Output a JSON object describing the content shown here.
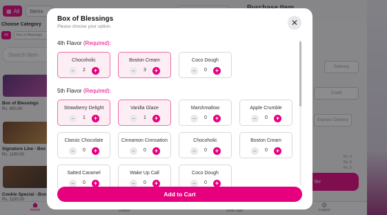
{
  "background": {
    "filter_all": "All",
    "filter_items": "Items",
    "purchase_title": "Purchase Item",
    "choose_category": "Choose Category",
    "category_all": "All",
    "category_box": "Box of Blessings",
    "search_placeholder": "Search Item",
    "products": [
      {
        "name": "Box of Blessings",
        "price": "Rs. 900.00"
      },
      {
        "name": "Signature Line - Box O",
        "price": "Rs. 1100.00"
      },
      {
        "name": "Cookie Special - Box O",
        "price": "Rs. 1100.00"
      }
    ],
    "right_buttons": {
      "delivery": "Delivery",
      "credit": "Credit",
      "express_delivery": "Express Delivery"
    },
    "right_pink_label": "ller",
    "rs_values": [
      "Rs. 0",
      "Rs. 0",
      "Rs. 0"
    ],
    "nav": [
      {
        "label": "Home",
        "icon": "home-icon"
      },
      {
        "label": "Orders"
      },
      {
        "label": "Shift Logs"
      },
      {
        "label": "Logout",
        "icon": "logout-icon"
      }
    ]
  },
  "modal": {
    "title": "Box of Blessings",
    "subtitle": "Please choose your option.",
    "close_icon": "close-icon",
    "required_text": "(Required):",
    "add_to_cart": "Add to Cart",
    "sections": [
      {
        "label": "4th Flavor",
        "items": [
          {
            "name": "Chocoholic",
            "count": "2",
            "selected": true
          },
          {
            "name": "Boston Cream",
            "count": "3",
            "selected": true
          },
          {
            "name": "Coco Dough",
            "count": "0",
            "selected": false
          }
        ]
      },
      {
        "label": "5th Flavor",
        "items": [
          {
            "name": "Strawberry Delight",
            "count": "1",
            "selected": true
          },
          {
            "name": "Vanilla Glaze",
            "count": "1",
            "selected": true
          },
          {
            "name": "Marshmallow",
            "count": "0",
            "selected": false
          },
          {
            "name": "Apple Crumble",
            "count": "0",
            "selected": false
          },
          {
            "name": "Classic Chocolate",
            "count": "0",
            "selected": false
          },
          {
            "name": "Cinnamon Cinnsation",
            "count": "0",
            "selected": false
          },
          {
            "name": "Chocoholic",
            "count": "0",
            "selected": false
          },
          {
            "name": "Boston Cream",
            "count": "0",
            "selected": false
          },
          {
            "name": "Salted Caramel",
            "count": "0",
            "selected": false
          },
          {
            "name": "Wake Up Call",
            "count": "0",
            "selected": false
          },
          {
            "name": "Coco Dough",
            "count": "0",
            "selected": false
          }
        ]
      }
    ]
  },
  "colors": {
    "accent": "#e6007e",
    "selected_bg": "#fdeef5",
    "selected_border": "#f06aa8"
  }
}
